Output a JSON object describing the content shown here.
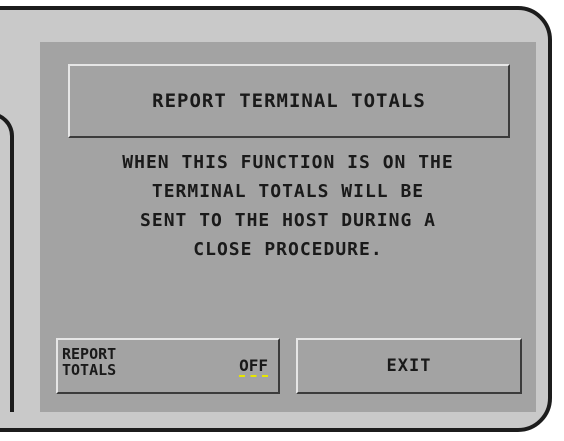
{
  "screen": {
    "title": "REPORT TERMINAL TOTALS",
    "message_lines": [
      "WHEN THIS FUNCTION IS ON THE",
      "TERMINAL TOTALS WILL BE",
      "SENT TO THE HOST DURING A",
      "CLOSE PROCEDURE."
    ]
  },
  "buttons": {
    "report_totals": {
      "label_line1": "REPORT",
      "label_line2": "TOTALS",
      "value": "OFF"
    },
    "exit": {
      "label": "EXIT"
    }
  },
  "colors": {
    "screen_bg": "#a3a3a3",
    "bezel": "#c9c9c9",
    "value_underline": "#e6e600"
  }
}
